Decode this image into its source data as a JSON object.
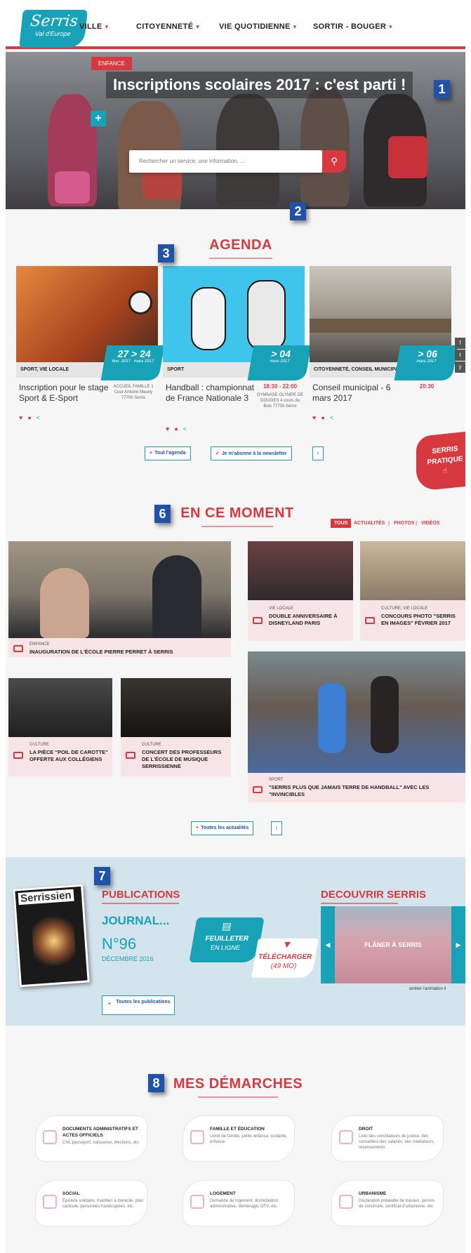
{
  "header": {
    "logo_main": "Serris",
    "logo_sub": "Val d'Europe",
    "nav": [
      "VILLE",
      "CITOYENNETÉ",
      "VIE QUOTIDIENNE",
      "SORTIR - BOUGER"
    ]
  },
  "hero": {
    "tag": "ENFANCE",
    "title": "Inscriptions scolaires 2017 : c'est parti !",
    "plus": "+"
  },
  "search": {
    "placeholder": "Rechercher un service, une information, ..."
  },
  "badges": [
    "1",
    "2",
    "3",
    "6",
    "7",
    "8"
  ],
  "agenda": {
    "title": "AGENDA",
    "events": [
      {
        "category": "SPORT, VIE LOCALE",
        "date_from": "27",
        "month_from": "févr. 2017",
        "date_to": "24",
        "month_to": "mars 2017",
        "title": "Inscription pour le stage Sport & E-Sport",
        "info": "ACCUEIL FAMILLE 1 Cour Antoine Mauny 77700 Serris",
        "time": ""
      },
      {
        "category": "SPORT",
        "date_from": "",
        "month_from": "",
        "date_to": "04",
        "month_to": "mars 2017",
        "title": "Handball : championnat de France Nationale 3",
        "info": "GYMNASE OLYMPE DE GOUGES 4 cours du Bois 77700 Serris",
        "time": "18:30 - 22:00"
      },
      {
        "category": "CITOYENNETÉ, CONSEIL MUNICIPAL",
        "date_from": "",
        "month_from": "",
        "date_to": "06",
        "month_to": "mars 2017",
        "title": "Conseil municipal - 6 mars 2017",
        "info": "",
        "time": "20:30"
      }
    ],
    "btn_all": "Tout l'agenda",
    "btn_newsletter": "Je m'abonne à la newsletter",
    "btn_rss": "∶"
  },
  "pratique": {
    "line1": "SERRIS",
    "line2": "PRATIQUE"
  },
  "social_side": [
    "f",
    "t",
    "y"
  ],
  "moment": {
    "title": "EN CE MOMENT",
    "tabs": [
      "TOUS",
      "ACTUALITÉS",
      "PHOTOS",
      "VIDÉOS"
    ],
    "items": [
      {
        "category": "ENFANCE",
        "title": "INAUGURATION DE L'ÉCOLE PIERRE PERRET À SERRIS"
      },
      {
        "category": "VIE LOCALE",
        "title": "DOUBLE ANNIVERSAIRE À DISNEYLAND PARIS"
      },
      {
        "category": "CULTURE, VIE LOCALE",
        "title": "CONCOURS PHOTO \"SERRIS EN IMAGES\" FÉVRIER 2017"
      },
      {
        "category": "CULTURE",
        "title": "LA PIÈCE \"POIL DE CAROTTE\" OFFERTE AUX COLLÉGIENS"
      },
      {
        "category": "CULTURE",
        "title": "CONCERT DES PROFESSEURS DE L'ÉCOLE DE MUSIQUE SERRISSIENNE"
      },
      {
        "category": "SPORT",
        "title": "\"SERRIS PLUS QUE JAMAIS TERRE DE HANDBALL\" AVEC LES \"INVINCIBLES"
      }
    ],
    "btn_all": "Toutes les actualités"
  },
  "publications": {
    "title": "PUBLICATIONS",
    "mag_title": "Serrissien",
    "journal": "JOURNAL...",
    "number": "N°96",
    "date": "DÉCEMBRE 2016",
    "feuilleter_1": "FEUILLETER",
    "feuilleter_2": "EN LIGNE",
    "telecharger": "TÉLÉCHARGER",
    "size": "(49 MO)",
    "btn_all": "Toutes les publications"
  },
  "decouvrir": {
    "title": "DECOUVRIR SERRIS",
    "slide": "FLÂNER À SERRIS",
    "pause": "arrêter l'animation"
  },
  "demarches": {
    "title": "MES DÉMARCHES",
    "items": [
      {
        "title": "DOCUMENTS ADMINISTRATIFS ET ACTES OFFICIELS",
        "desc": "CNI, passeport, naissance, élections, etc."
      },
      {
        "title": "FAMILLE ET ÉDUCATION",
        "desc": "Livret de famille, petite enfance, scolarité, enfance"
      },
      {
        "title": "DROIT",
        "desc": "Liste des conciliateurs de justice, des conseillers des salariés, des médiateurs, recensements"
      },
      {
        "title": "SOCIAL",
        "desc": "Épicerie solidaire, maintien à domicile, plan canicule, personnes handicapées, etc."
      },
      {
        "title": "LOGEMENT",
        "desc": "Demande de logement, domiciliation administrative, déménagé, OTV, etc."
      },
      {
        "title": "URBANISME",
        "desc": "Déclaration préalable de travaux, permis de construire, certificat d'urbanisme, etc."
      }
    ]
  }
}
